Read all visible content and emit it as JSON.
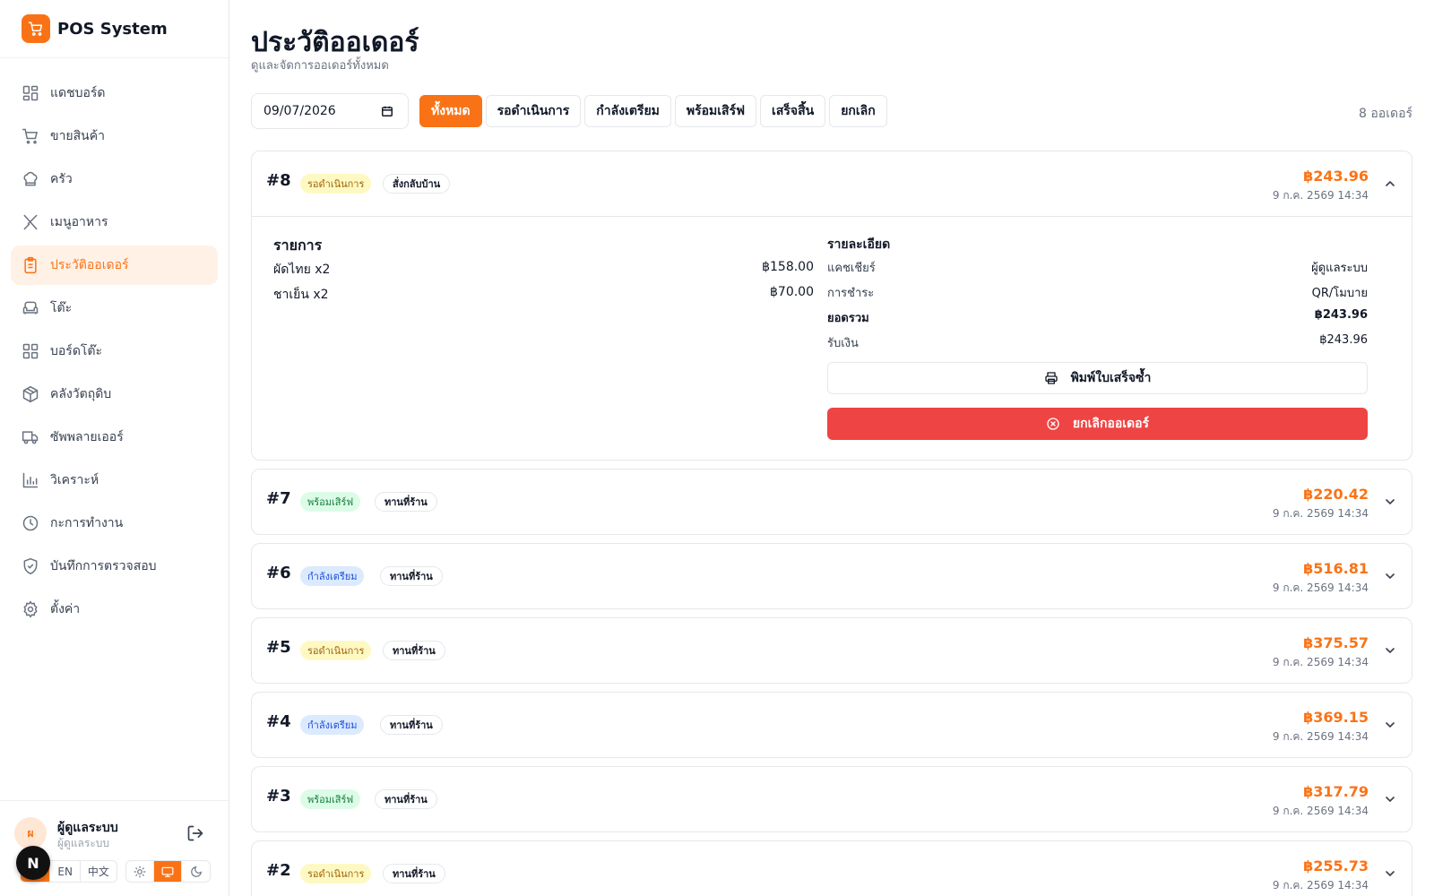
{
  "app": {
    "title": "POS System"
  },
  "sidebar": {
    "items": [
      {
        "label": "แดชบอร์ด",
        "icon": "dashboard-icon"
      },
      {
        "label": "ขายสินค้า",
        "icon": "cart-icon"
      },
      {
        "label": "ครัว",
        "icon": "chef-hat-icon"
      },
      {
        "label": "เมนูอาหาร",
        "icon": "utensils-icon"
      },
      {
        "label": "ประวัติออเดอร์",
        "icon": "clipboard-icon",
        "active": true
      },
      {
        "label": "โต๊ะ",
        "icon": "armchair-icon"
      },
      {
        "label": "บอร์ดโต๊ะ",
        "icon": "grid-icon"
      },
      {
        "label": "คลังวัตถุดิบ",
        "icon": "package-icon"
      },
      {
        "label": "ซัพพลายเออร์",
        "icon": "truck-icon"
      },
      {
        "label": "วิเคราะห์",
        "icon": "chart-icon"
      },
      {
        "label": "กะการทำงาน",
        "icon": "clock-icon"
      },
      {
        "label": "บันทึกการตรวจสอบ",
        "icon": "shield-icon"
      },
      {
        "label": "ตั้งค่า",
        "icon": "gear-icon"
      }
    ],
    "user": {
      "initial": "ผ",
      "name": "ผู้ดูแลระบบ",
      "role": "ผู้ดูแลระบบ"
    },
    "languages": [
      "TH",
      "EN",
      "中文"
    ],
    "floating_initial": "N"
  },
  "header": {
    "title": "ประวัติออเดอร์",
    "subtitle": "ดูและจัดการออเดอร์ทั้งหมด"
  },
  "filters": {
    "date": "09/07/2026",
    "chips": [
      "ทั้งหมด",
      "รอดำเนินการ",
      "กำลังเตรียม",
      "พร้อมเสิร์ฟ",
      "เสร็จสิ้น",
      "ยกเลิก"
    ],
    "active_chip": "ทั้งหมด",
    "count_label": "8 ออเดอร์"
  },
  "orders": [
    {
      "number": "#8",
      "status": "รอดำเนินการ",
      "status_kind": "pending",
      "type": "สั่งกลับบ้าน",
      "total": "฿243.96",
      "time": "9 ก.ค. 2569 14:34",
      "expanded": true,
      "items_title": "รายการ",
      "items": [
        {
          "name": "ผัดไทย x2",
          "amount": "฿158.00"
        },
        {
          "name": "ชาเย็น x2",
          "amount": "฿70.00"
        }
      ],
      "details_title": "รายละเอียด",
      "details": [
        {
          "label": "แคชเชียร์",
          "value": "ผู้ดูแลระบบ"
        },
        {
          "label": "การชำระ",
          "value": "QR/โมบาย"
        },
        {
          "label": "ยอดรวม",
          "value": "฿243.96",
          "bold": true
        },
        {
          "label": "รับเงิน",
          "value": "฿243.96"
        }
      ],
      "print_label": "พิมพ์ใบเสร็จซ้ำ",
      "cancel_label": "ยกเลิกออเดอร์"
    },
    {
      "number": "#7",
      "status": "พร้อมเสิร์ฟ",
      "status_kind": "ready",
      "type": "ทานที่ร้าน",
      "total": "฿220.42",
      "time": "9 ก.ค. 2569 14:34"
    },
    {
      "number": "#6",
      "status": "กำลังเตรียม",
      "status_kind": "prep",
      "type": "ทานที่ร้าน",
      "total": "฿516.81",
      "time": "9 ก.ค. 2569 14:34"
    },
    {
      "number": "#5",
      "status": "รอดำเนินการ",
      "status_kind": "pending",
      "type": "ทานที่ร้าน",
      "total": "฿375.57",
      "time": "9 ก.ค. 2569 14:34"
    },
    {
      "number": "#4",
      "status": "กำลังเตรียม",
      "status_kind": "prep",
      "type": "ทานที่ร้าน",
      "total": "฿369.15",
      "time": "9 ก.ค. 2569 14:34"
    },
    {
      "number": "#3",
      "status": "พร้อมเสิร์ฟ",
      "status_kind": "ready",
      "type": "ทานที่ร้าน",
      "total": "฿317.79",
      "time": "9 ก.ค. 2569 14:34"
    },
    {
      "number": "#2",
      "status": "รอดำเนินการ",
      "status_kind": "pending",
      "type": "ทานที่ร้าน",
      "total": "฿255.73",
      "time": "9 ก.ค. 2569 14:34"
    }
  ],
  "colors": {
    "accent": "#f97316",
    "danger": "#ef4444",
    "pending_bg": "#fef9c3",
    "ready_bg": "#dcfce7",
    "prep_bg": "#dbeafe"
  }
}
